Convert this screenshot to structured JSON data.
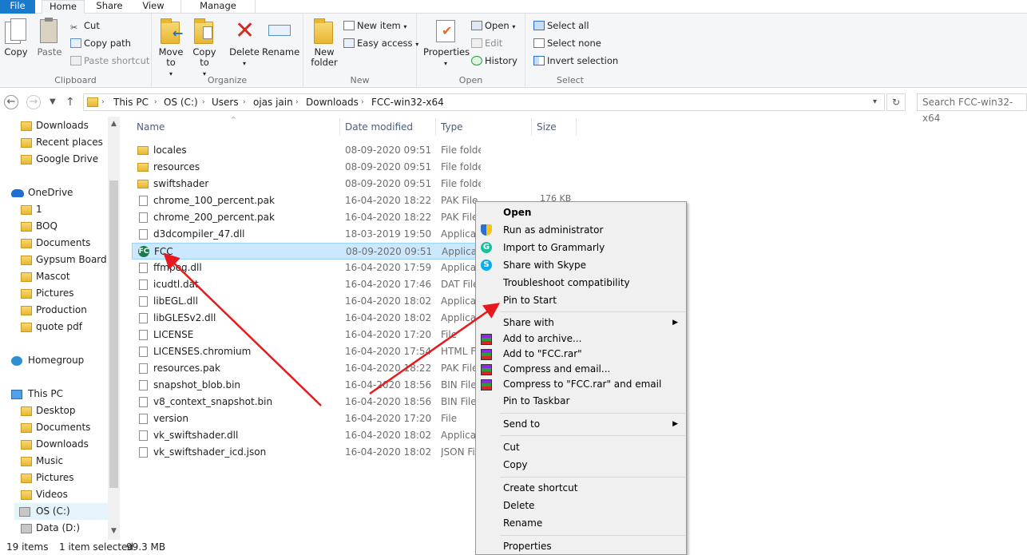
{
  "ribbon_tabs": [
    "File",
    "Home",
    "Share",
    "View",
    "Manage"
  ],
  "clipboard": {
    "copy": "Copy",
    "paste": "Paste",
    "cut": "Cut",
    "copy_path": "Copy path",
    "paste_shortcut": "Paste shortcut",
    "label": "Clipboard"
  },
  "organize": {
    "move_to": "Move to",
    "copy_to": "Copy to",
    "delete": "Delete",
    "rename": "Rename",
    "label": "Organize"
  },
  "new": {
    "new_folder": "New folder",
    "new_item": "New item",
    "easy_access": "Easy access",
    "label": "New"
  },
  "open": {
    "properties": "Properties",
    "open": "Open",
    "edit": "Edit",
    "history": "History",
    "label": "Open"
  },
  "select": {
    "select_all": "Select all",
    "select_none": "Select none",
    "invert": "Invert selection",
    "label": "Select"
  },
  "address": {
    "crumbs": [
      "This PC",
      "OS (C:)",
      "Users",
      "ojas jain",
      "Downloads",
      "FCC-win32-x64"
    ],
    "search_placeholder": "Search FCC-win32-x64"
  },
  "nav": {
    "quick": [
      "Downloads",
      "Recent places",
      "Google Drive"
    ],
    "onedrive": "OneDrive",
    "onedrive_items": [
      "1",
      "BOQ",
      "Documents",
      "Gypsum Board",
      "Mascot",
      "Pictures",
      "Production",
      "quote pdf"
    ],
    "homegroup": "Homegroup",
    "thispc": "This PC",
    "pc_items": [
      "Desktop",
      "Documents",
      "Downloads",
      "Music",
      "Pictures",
      "Videos",
      "OS (C:)",
      "Data (D:)"
    ]
  },
  "columns": {
    "name": "Name",
    "date": "Date modified",
    "type": "Type",
    "size": "Size"
  },
  "files": [
    {
      "name": "locales",
      "date": "08-09-2020 09:51",
      "type": "File folder",
      "kind": "folder"
    },
    {
      "name": "resources",
      "date": "08-09-2020 09:51",
      "type": "File folder",
      "kind": "folder"
    },
    {
      "name": "swiftshader",
      "date": "08-09-2020 09:51",
      "type": "File folder",
      "kind": "folder"
    },
    {
      "name": "chrome_100_percent.pak",
      "date": "16-04-2020 18:22",
      "type": "PAK File",
      "kind": "file"
    },
    {
      "name": "chrome_200_percent.pak",
      "date": "16-04-2020 18:22",
      "type": "PAK File",
      "kind": "file"
    },
    {
      "name": "d3dcompiler_47.dll",
      "date": "18-03-2019 19:50",
      "type": "Applicat",
      "kind": "file"
    },
    {
      "name": "FCC",
      "date": "08-09-2020 09:51",
      "type": "Applicat",
      "kind": "app"
    },
    {
      "name": "ffmpeg.dll",
      "date": "16-04-2020 17:59",
      "type": "Applicat",
      "kind": "file"
    },
    {
      "name": "icudtl.dat",
      "date": "16-04-2020 17:46",
      "type": "DAT File",
      "kind": "file"
    },
    {
      "name": "libEGL.dll",
      "date": "16-04-2020 18:02",
      "type": "Applicat",
      "kind": "file"
    },
    {
      "name": "libGLESv2.dll",
      "date": "16-04-2020 18:02",
      "type": "Applicat",
      "kind": "file"
    },
    {
      "name": "LICENSE",
      "date": "16-04-2020 17:20",
      "type": "File",
      "kind": "file"
    },
    {
      "name": "LICENSES.chromium",
      "date": "16-04-2020 17:54",
      "type": "HTML Fi",
      "kind": "file"
    },
    {
      "name": "resources.pak",
      "date": "16-04-2020 18:22",
      "type": "PAK File",
      "kind": "file"
    },
    {
      "name": "snapshot_blob.bin",
      "date": "16-04-2020 18:56",
      "type": "BIN File",
      "kind": "file"
    },
    {
      "name": "v8_context_snapshot.bin",
      "date": "16-04-2020 18:56",
      "type": "BIN File",
      "kind": "file"
    },
    {
      "name": "version",
      "date": "16-04-2020 17:20",
      "type": "File",
      "kind": "file"
    },
    {
      "name": "vk_swiftshader.dll",
      "date": "16-04-2020 18:02",
      "type": "Applicat",
      "kind": "file"
    },
    {
      "name": "vk_swiftshader_icd.json",
      "date": "16-04-2020 18:02",
      "type": "JSON Fil",
      "kind": "file"
    }
  ],
  "size_fragment": "176 KB",
  "status": {
    "count": "19 items",
    "selected": "1 item selected",
    "size": "99.3 MB"
  },
  "context_menu": {
    "open": "Open",
    "run_admin": "Run as administrator",
    "grammarly": "Import to Grammarly",
    "skype": "Share with Skype",
    "troubleshoot": "Troubleshoot compatibility",
    "pin_start": "Pin to Start",
    "share_with": "Share with",
    "add_archive": "Add to archive...",
    "add_rar": "Add to \"FCC.rar\"",
    "compress_email": "Compress and email...",
    "compress_rar_email": "Compress to \"FCC.rar\" and email",
    "pin_taskbar": "Pin to Taskbar",
    "send_to": "Send to",
    "cut": "Cut",
    "copy": "Copy",
    "create_shortcut": "Create shortcut",
    "delete": "Delete",
    "rename": "Rename",
    "properties": "Properties"
  },
  "colors": {
    "accent": "#1979ca",
    "selection": "#cce8ff",
    "arrow": "#e8191c"
  }
}
